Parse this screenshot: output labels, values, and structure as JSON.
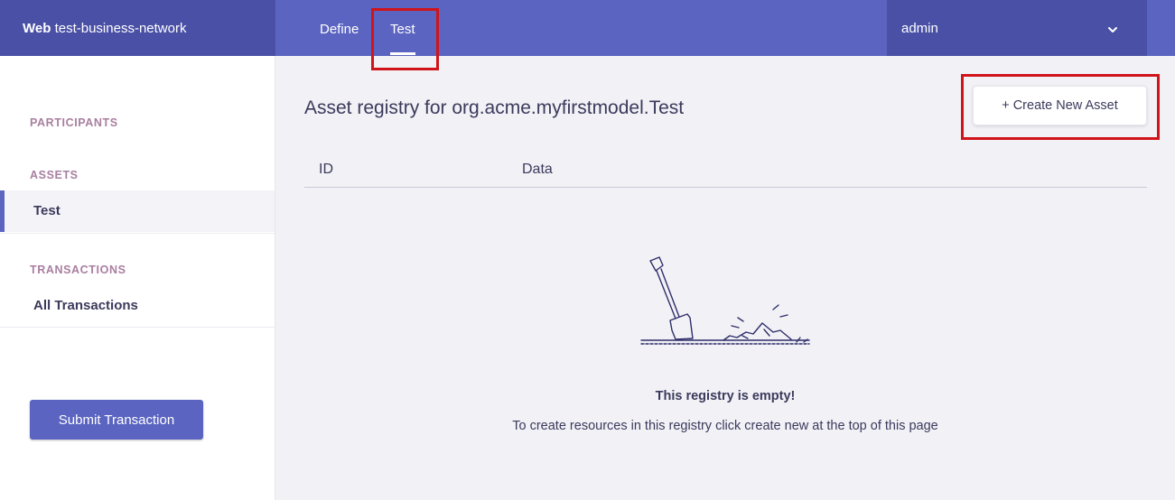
{
  "header": {
    "brand_bold": "Web",
    "brand_name": "test-business-network",
    "tabs": [
      {
        "label": "Define",
        "active": false
      },
      {
        "label": "Test",
        "active": true
      }
    ],
    "user": "admin"
  },
  "sidebar": {
    "sections": [
      {
        "heading": "PARTICIPANTS",
        "items": []
      },
      {
        "heading": "ASSETS",
        "items": [
          {
            "label": "Test",
            "active": true
          }
        ]
      },
      {
        "heading": "TRANSACTIONS",
        "items": [
          {
            "label": "All Transactions",
            "active": false
          }
        ]
      }
    ],
    "submit_label": "Submit Transaction"
  },
  "main": {
    "title": "Asset registry for org.acme.myfirstmodel.Test",
    "create_label": "+ Create New Asset",
    "columns": [
      "ID",
      "Data"
    ],
    "empty_title": "This registry is empty!",
    "empty_desc": "To create resources in this registry click create new at the top of this page"
  },
  "colors": {
    "primary": "#5b64c0",
    "primary_dark": "#4a50a6",
    "section_heading": "#a97fa0",
    "annotation_red": "#d0141a"
  },
  "icons": {
    "user_menu": "chevron-down-icon",
    "empty_state": "shovel-icon"
  }
}
